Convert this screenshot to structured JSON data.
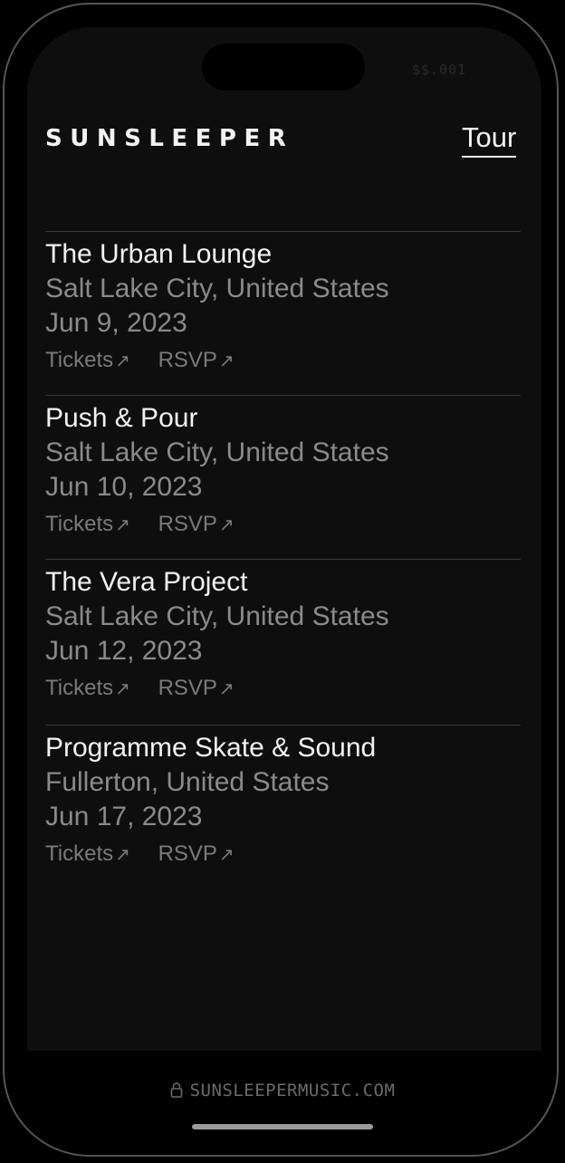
{
  "status": {
    "text": "$$.001"
  },
  "header": {
    "brand": "SUNSLEEPER",
    "nav_tour": "Tour"
  },
  "tour": [
    {
      "venue": "The Urban Lounge",
      "location": "Salt Lake City, United States",
      "date": "Jun 9, 2023",
      "tickets_label": "Tickets",
      "rsvp_label": "RSVP"
    },
    {
      "venue": "Push & Pour",
      "location": "Salt Lake City, United States",
      "date": "Jun 10, 2023",
      "tickets_label": "Tickets",
      "rsvp_label": "RSVP"
    },
    {
      "venue": "The Vera Project",
      "location": "Salt Lake City, United States",
      "date": "Jun 12, 2023",
      "tickets_label": "Tickets",
      "rsvp_label": "RSVP"
    },
    {
      "venue": "Programme Skate & Sound",
      "location": "Fullerton, United States",
      "date": "Jun 17, 2023",
      "tickets_label": "Tickets",
      "rsvp_label": "RSVP"
    }
  ],
  "browser": {
    "url": "SUNSLEEPERMUSIC.COM"
  }
}
